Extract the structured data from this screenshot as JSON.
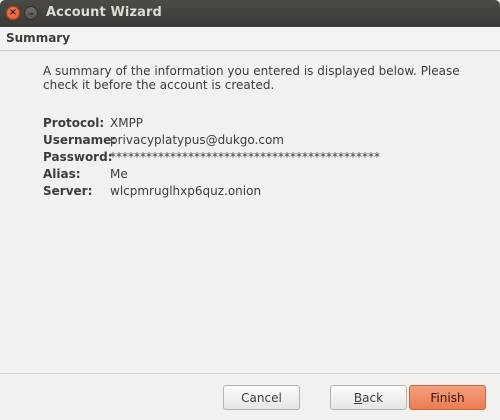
{
  "window": {
    "title": "Account Wizard",
    "close_glyph": "×",
    "minimize_glyph": "–"
  },
  "header": {
    "title": "Summary"
  },
  "intro": {
    "line1": "A summary of the information you entered is displayed below. Please",
    "line2": "check it before the account is created."
  },
  "details": [
    {
      "label": "Protocol:",
      "value": "XMPP"
    },
    {
      "label": "Username:",
      "value": "privacyplatypus@dukgo.com"
    },
    {
      "label": "Password:",
      "value": "*********************************************"
    },
    {
      "label": "Alias:",
      "value": "Me"
    },
    {
      "label": "Server:",
      "value": "wlcpmruglhxp6quz.onion"
    }
  ],
  "buttons": {
    "cancel": "Cancel",
    "back_mnemonic": "B",
    "back_rest": "ack",
    "finish": "Finish"
  },
  "colors": {
    "accent": "#ec7c51",
    "titlebar": "#3c3b37"
  }
}
